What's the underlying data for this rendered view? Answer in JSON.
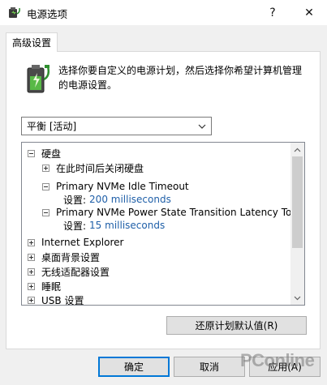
{
  "window": {
    "title": "电源选项",
    "help_glyph": "?",
    "close_glyph": "✕"
  },
  "tab": {
    "label": "高级设置"
  },
  "description": "选择你要自定义的电源计划，然后选择你希望计算机管理的电源设置。",
  "plan_select": {
    "selected": "平衡 [活动]"
  },
  "tree": {
    "items": [
      {
        "label": "硬盘",
        "expander": "minus"
      },
      {
        "label": "在此时间后关闭硬盘",
        "expander": "plus"
      },
      {
        "label": "Primary NVMe Idle Timeout",
        "expander": "minus",
        "value_label": "设置:",
        "value": "200 milliseconds"
      },
      {
        "label": "Primary NVMe Power State Transition Latency Tolerance",
        "expander": "minus",
        "value_label": "设置:",
        "value": "15 milliseconds"
      },
      {
        "label": "Internet Explorer",
        "expander": "plus"
      },
      {
        "label": "桌面背景设置",
        "expander": "plus"
      },
      {
        "label": "无线适配器设置",
        "expander": "plus"
      },
      {
        "label": "睡眠",
        "expander": "plus"
      },
      {
        "label": "USB 设置",
        "expander": "plus"
      }
    ]
  },
  "buttons": {
    "restore": "还原计划默认值(R)",
    "ok": "确定",
    "cancel": "取消",
    "apply": "应用(A)"
  },
  "watermark": "PConline",
  "colors": {
    "setting_value": "#1f5fa8",
    "dialog_bg": "#f0f0f0",
    "default_button_border": "#0078d7"
  }
}
